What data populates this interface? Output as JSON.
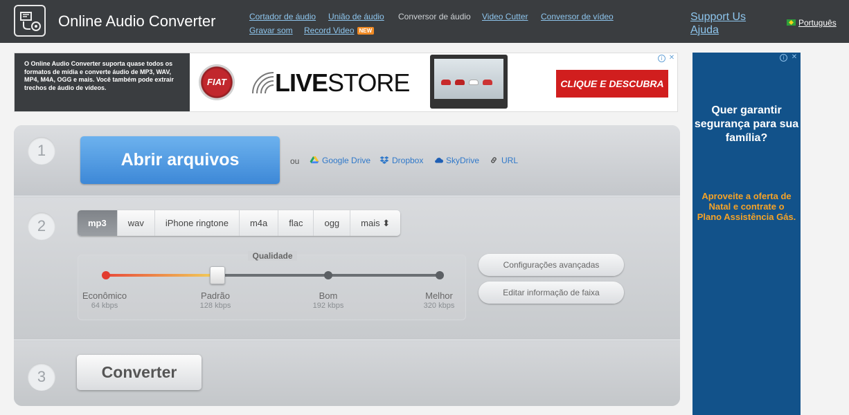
{
  "header": {
    "title": "Online Audio Converter",
    "nav": [
      {
        "label": "Cortador de áudio",
        "current": false
      },
      {
        "label": "União de áudio",
        "current": false
      },
      {
        "label": "Conversor de áudio",
        "current": true
      },
      {
        "label": "Video Cutter",
        "current": false
      },
      {
        "label": "Conversor de vídeo",
        "current": false
      },
      {
        "label": "Gravar som",
        "current": false
      },
      {
        "label": "Record Video",
        "current": false,
        "badge": "NEW"
      }
    ],
    "support": "Support Us",
    "help": "Ajuda",
    "language": "Português"
  },
  "ad_top": {
    "text": "O Online Audio Converter suporta quase todos os formatos de mídia e converte áudio de MP3, WAV, MP4, M4A, OGG e mais. Você também pode extrair trechos de áudio de vídeos.",
    "brand": "FIAT",
    "store_bold": "LIVE",
    "store_rest": "STORE",
    "cta": "CLIQUE E DESCUBRA"
  },
  "ad_right": {
    "question": "Quer garantir segurança para sua família?",
    "offer": "Aproveite a oferta de Natal e contrate o Plano Assistência Gás."
  },
  "step1": {
    "number": "1",
    "open_button": "Abrir arquivos",
    "or": "ou",
    "sources": [
      "Google Drive",
      "Dropbox",
      "SkyDrive",
      "URL"
    ]
  },
  "step2": {
    "number": "2",
    "formats": [
      "mp3",
      "wav",
      "iPhone ringtone",
      "m4a",
      "flac",
      "ogg",
      "mais ⬍"
    ],
    "selected_format": "mp3",
    "quality_title": "Qualidade",
    "quality_level": 1,
    "quality_marks": [
      {
        "label": "Econômico",
        "kbps": "64 kbps"
      },
      {
        "label": "Padrão",
        "kbps": "128 kbps"
      },
      {
        "label": "Bom",
        "kbps": "192 kbps"
      },
      {
        "label": "Melhor",
        "kbps": "320 kbps"
      }
    ],
    "advanced_settings": "Configurações avançadas",
    "edit_track_info": "Editar informação de faixa"
  },
  "step3": {
    "number": "3",
    "convert_button": "Converter"
  },
  "colors": {
    "header_bg": "#3a3d40",
    "link": "#8ec6ee",
    "open_button": "#4a95dd",
    "ad_right_bg": "#12528a",
    "offer_text": "#f7a326",
    "cta_red": "#d11e1e"
  }
}
